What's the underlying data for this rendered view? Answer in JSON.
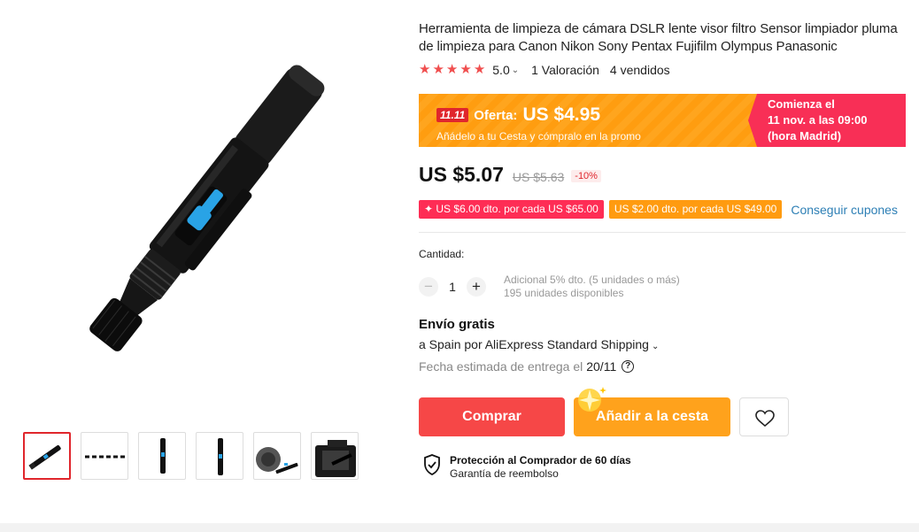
{
  "gallery": {
    "main_image_name": "lens-cleaning-pen-photo",
    "thumbnails": [
      {
        "name": "thumb-pen-diagonal",
        "active": true
      },
      {
        "name": "thumb-pen-horizontal",
        "active": false
      },
      {
        "name": "thumb-pen-vertical",
        "active": false
      },
      {
        "name": "thumb-pen-vertical-2",
        "active": false
      },
      {
        "name": "thumb-pen-with-lens",
        "active": false
      },
      {
        "name": "thumb-camera",
        "active": false
      }
    ]
  },
  "product": {
    "title": "Herramienta de limpieza de cámara DSLR lente visor filtro Sensor limpiador pluma de limpieza para Canon Nikon Sony Pentax Fujifilm Olympus Panasonic",
    "rating": "5.0",
    "rating_count": "1 Valoración",
    "sold": "4 vendidos",
    "stars": 5
  },
  "promo": {
    "badge": "11.11",
    "label": "Oferta:",
    "price": "US $4.95",
    "sub": "Añádelo a tu Cesta y cómpralo en la promo",
    "starts_line1": "Comienza el",
    "starts_line2": "11 nov. a las 09:00",
    "starts_line3": "(hora Madrid)"
  },
  "price": {
    "current": "US $5.07",
    "original": "US $5.63",
    "discount": "-10%"
  },
  "coupons": {
    "coupon1": "✦ US $6.00 dto. por cada US $65.00",
    "coupon2": "US $2.00 dto. por cada US $49.00",
    "link": "Conseguir cupones"
  },
  "quantity": {
    "label": "Cantidad:",
    "minus": "−",
    "value": "1",
    "plus": "+",
    "extra_discount": "Adicional 5% dto. (5 unidades o más)",
    "available": "195 unidades disponibles"
  },
  "shipping": {
    "title": "Envío gratis",
    "line": "a Spain por AliExpress Standard Shipping",
    "delivery_label": "Fecha estimada de entrega el",
    "delivery_date": "20/11",
    "help": "?"
  },
  "actions": {
    "buy": "Comprar",
    "add_to_cart": "Añadir a la cesta"
  },
  "protection": {
    "title": "Protección al Comprador de 60 días",
    "subtitle": "Garantía de reembolso"
  },
  "colors": {
    "accent_red": "#f64747",
    "accent_orange": "#ffa21c",
    "promo_pink": "#f82f56",
    "link_blue": "#2d7fb5"
  }
}
